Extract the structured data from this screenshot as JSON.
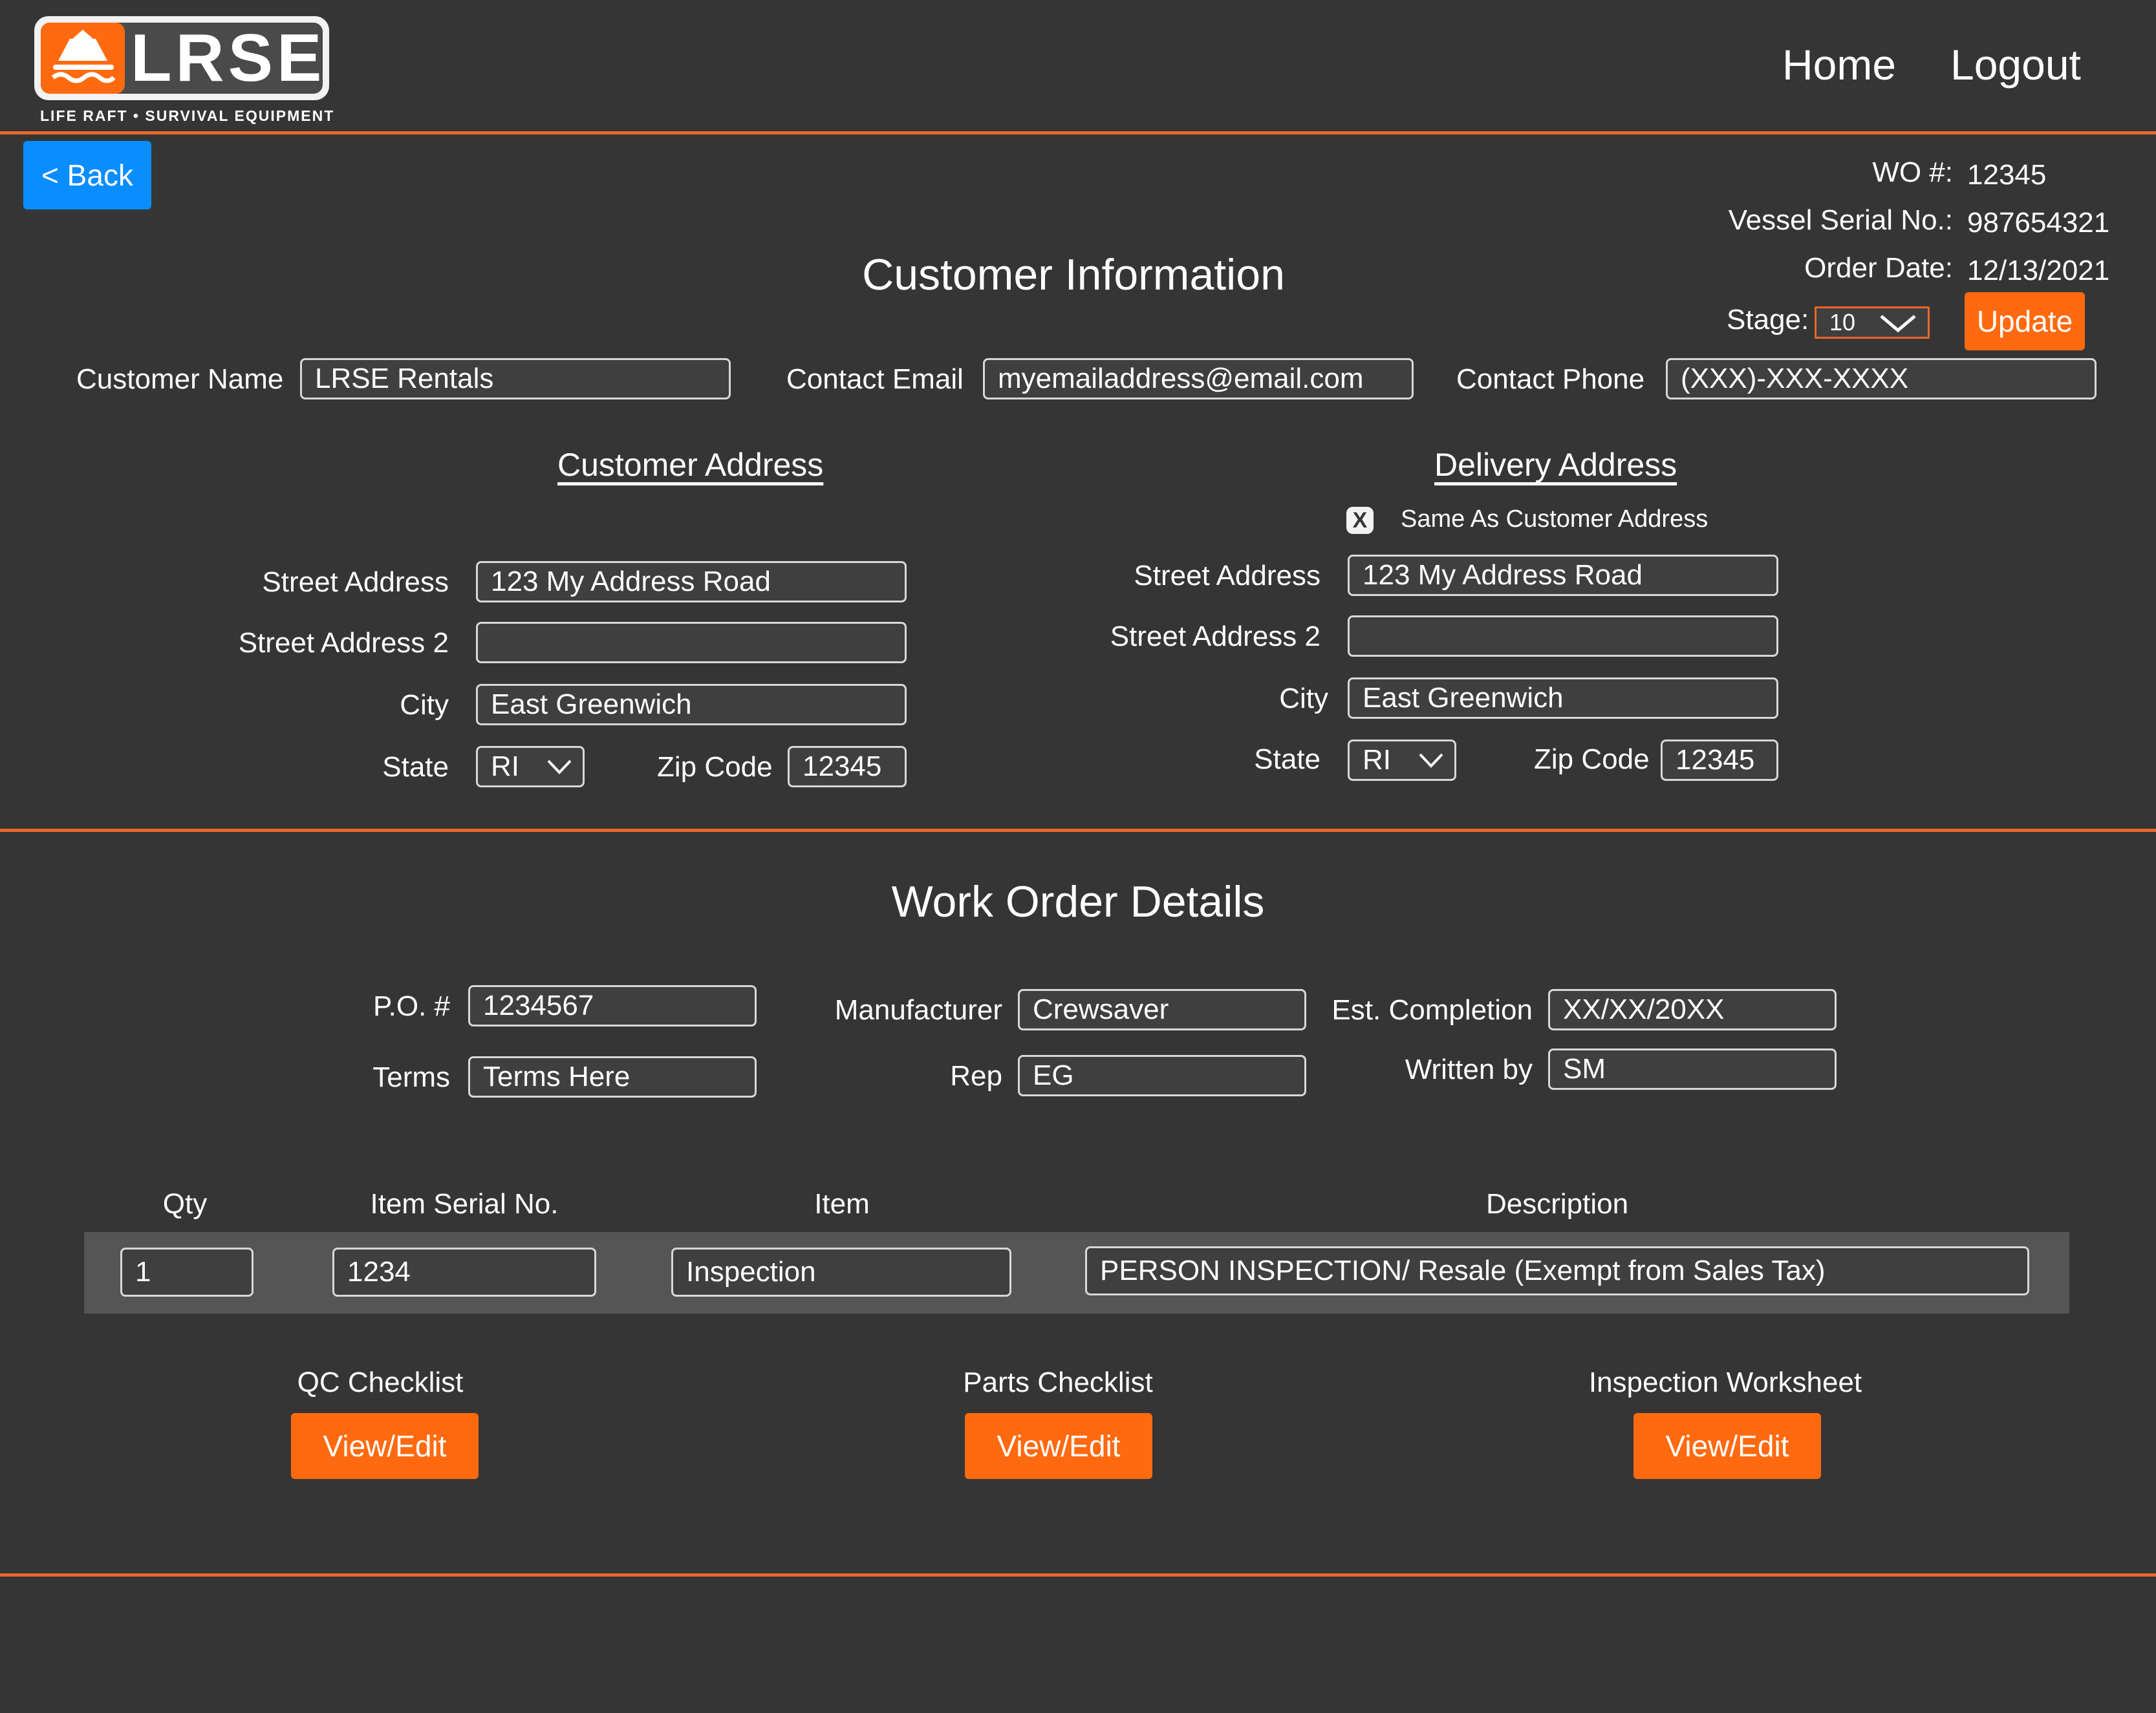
{
  "brand": {
    "logo_text": "LRSE",
    "tagline": "LIFE RAFT • SURVIVAL EQUIPMENT",
    "accent_color": "#ff6a10",
    "divider_color": "#e8682a",
    "background_color": "#353535"
  },
  "nav": {
    "home": "Home",
    "logout": "Logout"
  },
  "back_button": "< Back",
  "order_meta": {
    "wo_label": "WO #:",
    "wo_value": "12345",
    "vessel_label": "Vessel Serial No.:",
    "vessel_value": "987654321",
    "date_label": "Order Date:",
    "date_value": "12/13/2021",
    "stage_label": "Stage:",
    "stage_value": "10",
    "update_button": "Update"
  },
  "customer_info": {
    "title": "Customer Information",
    "name_label": "Customer Name",
    "name_value": "LRSE Rentals",
    "email_label": "Contact Email",
    "email_value": "myemailaddress@email.com",
    "phone_label": "Contact Phone",
    "phone_value": "(XXX)-XXX-XXXX"
  },
  "customer_address": {
    "title": "Customer Address",
    "street_label": "Street Address",
    "street_value": "123 My Address Road",
    "street2_label": "Street Address 2",
    "street2_value": "",
    "city_label": "City",
    "city_value": "East Greenwich",
    "state_label": "State",
    "state_value": "RI",
    "zip_label": "Zip Code",
    "zip_value": "12345"
  },
  "delivery_address": {
    "title": "Delivery Address",
    "same_checkbox_mark": "X",
    "same_label": "Same As Customer Address",
    "street_label": "Street Address",
    "street_value": "123 My Address Road",
    "street2_label": "Street Address 2",
    "street2_value": "",
    "city_label": "City",
    "city_value": "East Greenwich",
    "state_label": "State",
    "state_value": "RI",
    "zip_label": "Zip Code",
    "zip_value": "12345"
  },
  "work_order": {
    "title": "Work Order Details",
    "po_label": "P.O. #",
    "po_value": "1234567",
    "terms_label": "Terms",
    "terms_value": "Terms Here",
    "manufacturer_label": "Manufacturer",
    "manufacturer_value": "Crewsaver",
    "rep_label": "Rep",
    "rep_value": "EG",
    "completion_label": "Est. Completion",
    "completion_value": "XX/XX/20XX",
    "written_label": "Written by",
    "written_value": "SM"
  },
  "items_table": {
    "headers": [
      "Qty",
      "Item Serial No.",
      "Item",
      "Description"
    ],
    "rows": [
      [
        "1",
        "1234",
        "Inspection",
        "PERSON INSPECTION/ Resale (Exempt from Sales Tax)"
      ]
    ]
  },
  "checklists": [
    {
      "label": "QC Checklist",
      "button": "View/Edit"
    },
    {
      "label": "Parts Checklist",
      "button": "View/Edit"
    },
    {
      "label": "Inspection Worksheet",
      "button": "View/Edit"
    }
  ]
}
